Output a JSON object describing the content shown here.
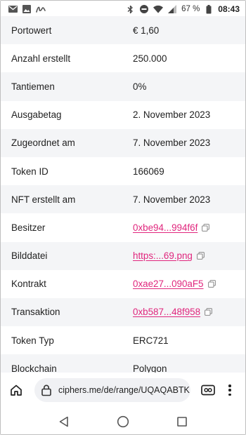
{
  "status_bar": {
    "left_icons": [
      "mail-icon",
      "image-icon",
      "signature-icon"
    ],
    "right_icons": [
      "bluetooth-icon",
      "do-not-disturb-icon",
      "wifi-icon",
      "signal-icon"
    ],
    "battery": "67 %",
    "time": "08:43"
  },
  "details": {
    "rows": [
      {
        "label": "Portowert",
        "value": "€ 1,60",
        "link": false
      },
      {
        "label": "Anzahl erstellt",
        "value": "250.000",
        "link": false
      },
      {
        "label": "Tantiemen",
        "value": "0%",
        "link": false
      },
      {
        "label": "Ausgabetag",
        "value": "2. November 2023",
        "link": false
      },
      {
        "label": "Zugeordnet am",
        "value": "7. November 2023",
        "link": false
      },
      {
        "label": "Token ID",
        "value": "166069",
        "link": false
      },
      {
        "label": "NFT erstellt am",
        "value": "7. November 2023",
        "link": false
      },
      {
        "label": "Besitzer",
        "value": "0xbe94...994f6f",
        "link": true
      },
      {
        "label": "Bilddatei",
        "value": "https:...69.png",
        "link": true
      },
      {
        "label": "Kontrakt",
        "value": "0xae27...090aF5",
        "link": true
      },
      {
        "label": "Transaktion",
        "value": "0xb587...48f958",
        "link": true
      },
      {
        "label": "Token Typ",
        "value": "ERC721",
        "link": false
      },
      {
        "label": "Blockchain",
        "value": "Polygon",
        "link": false
      }
    ]
  },
  "browser": {
    "url": "ciphers.me/de/range/UQAQABTK",
    "icons": [
      "home-icon",
      "lock-icon",
      "tab-switcher-icon",
      "more-vert-icon"
    ]
  },
  "nav": {
    "icons": [
      "back-icon",
      "home-circle-icon",
      "recents-icon"
    ]
  },
  "colors": {
    "link": "#e0267d",
    "row_alt": "#f4f5f7"
  }
}
